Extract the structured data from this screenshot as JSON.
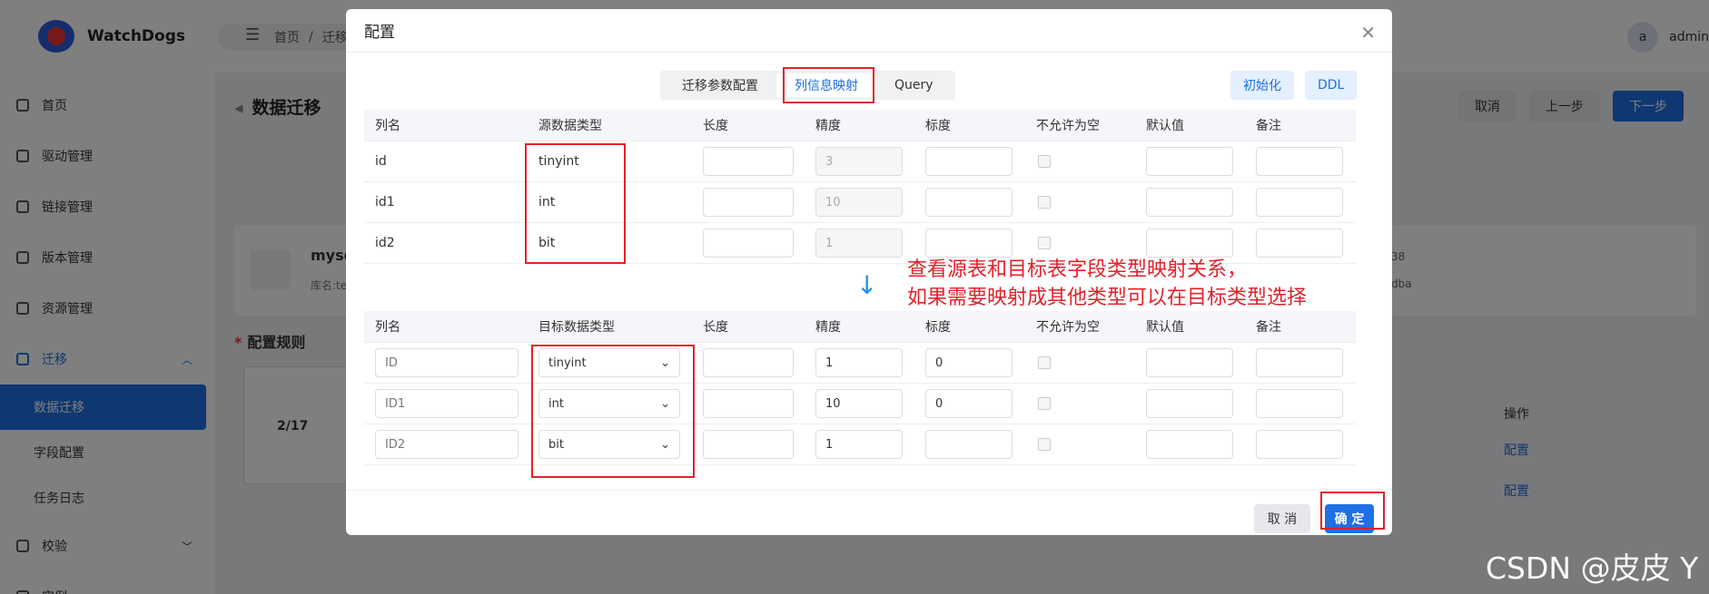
{
  "app": {
    "logo_text": "WatchDogs",
    "breadcrumb_home": "首页",
    "breadcrumb_sep": "/",
    "breadcrumb_next": "迁移",
    "user_initial": "a",
    "user_name": "admin"
  },
  "sidebar": {
    "items": [
      {
        "label": "首页"
      },
      {
        "label": "驱动管理"
      },
      {
        "label": "链接管理"
      },
      {
        "label": "版本管理"
      },
      {
        "label": "资源管理"
      },
      {
        "label": "迁移"
      }
    ],
    "sub_items": [
      {
        "label": "数据迁移"
      },
      {
        "label": "字段配置"
      },
      {
        "label": "任务日志"
      }
    ],
    "more": [
      {
        "label": "校验"
      },
      {
        "label": "实例"
      }
    ]
  },
  "page": {
    "title": "数据迁移",
    "cancel": "取消",
    "prev": "上一步",
    "next": "下一步",
    "card_name": "mysql",
    "card_sub": "库名:te",
    "right_info1": "38",
    "right_info2": "dba",
    "rule_title": "配置规则",
    "pager": "2/17",
    "op_head": "操作",
    "op_link1": "配置",
    "op_link2": "配置"
  },
  "dialog": {
    "title": "配置",
    "tabs": [
      "迁移参数配置",
      "列信息映射",
      "Query"
    ],
    "init_btn": "初始化",
    "ddl_btn": "DDL",
    "source_headers": [
      "列名",
      "源数据类型",
      "长度",
      "精度",
      "标度",
      "不允许为空",
      "默认值",
      "备注"
    ],
    "source_rows": [
      {
        "name": "id",
        "type": "tinyint",
        "precision": "3"
      },
      {
        "name": "id1",
        "type": "int",
        "precision": "10"
      },
      {
        "name": "id2",
        "type": "bit",
        "precision": "1"
      }
    ],
    "target_headers": [
      "列名",
      "目标数据类型",
      "长度",
      "精度",
      "标度",
      "不允许为空",
      "默认值",
      "备注"
    ],
    "target_rows": [
      {
        "name": "ID",
        "type": "tinyint",
        "precision": "1",
        "scale": "0"
      },
      {
        "name": "ID1",
        "type": "int",
        "precision": "10",
        "scale": "0"
      },
      {
        "name": "ID2",
        "type": "bit",
        "precision": "1",
        "scale": ""
      }
    ],
    "note_line1": "查看源表和目标表字段类型映射关系，",
    "note_line2": "如果需要映射成其他类型可以在目标类型选择",
    "cancel": "取 消",
    "ok": "确 定"
  },
  "watermark": "CSDN @皮皮 Y",
  "colors": {
    "accent": "#1f6fe5",
    "annotation": "#e3212b"
  }
}
